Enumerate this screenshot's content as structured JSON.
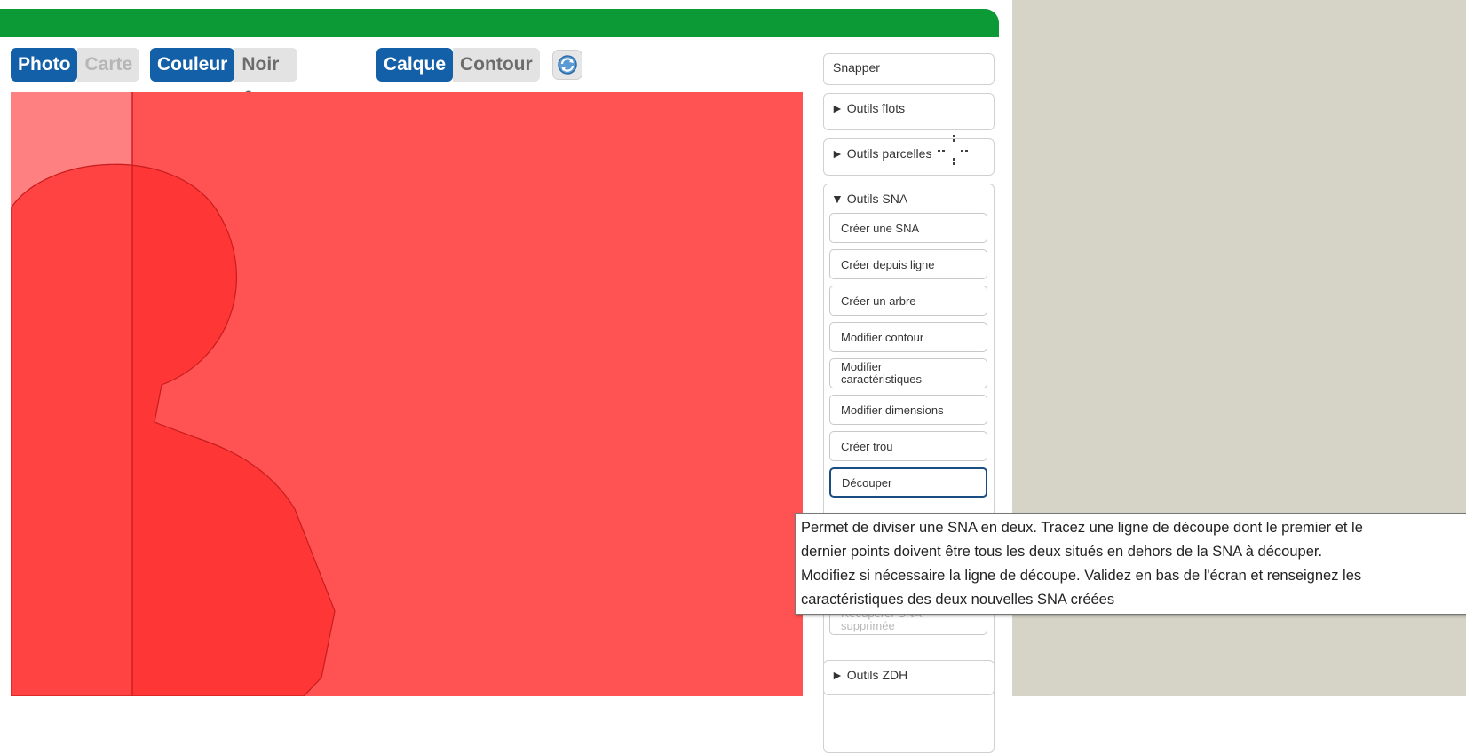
{
  "toolbar": {
    "photo": "Photo",
    "carte": "Carte",
    "couleur": "Couleur",
    "noir_blanc": "Noir & blanc",
    "calque": "Calque",
    "contour": "Contour",
    "refresh_icon": "refresh-icon"
  },
  "colors": {
    "topbar": "#0b9a35",
    "active": "#1360a8",
    "map_fill": "#ff5252"
  },
  "panel": {
    "snapper": "Snapper",
    "outils_ilots": "► Outils îlots",
    "outils_parcelles": "► Outils parcelles",
    "outils_sna": "▼ Outils SNA",
    "sna_buttons": {
      "creer_sna": "Créer une SNA",
      "creer_depuis_ligne": "Créer depuis ligne",
      "creer_arbre": "Créer un arbre",
      "modifier_contour": "Modifier contour",
      "modifier_carac_1": "Modifier",
      "modifier_carac_2": "caractéristiques",
      "modifier_dimensions": "Modifier dimensions",
      "creer_trou": "Créer trou",
      "decouper": "Découper",
      "recuperer_1": "Récupérer SNA",
      "recuperer_2": "supprimée"
    },
    "outils_zdh": "► Outils ZDH"
  },
  "tooltip": {
    "line1": "Permet de diviser une SNA en deux. Tracez une ligne de découpe dont le premier et le",
    "line2": "dernier points doivent être tous les deux situés en dehors de la SNA à découper.",
    "line3": "Modifiez si nécessaire la ligne de découpe. Validez en bas de l'écran et renseignez les",
    "line4": "caractéristiques des deux nouvelles SNA créées"
  }
}
